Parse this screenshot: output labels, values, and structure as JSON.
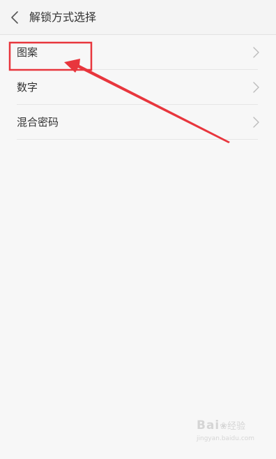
{
  "header": {
    "title": "解锁方式选择",
    "back_icon": "chevron-left-icon"
  },
  "options": [
    {
      "label": "图案",
      "icon": "chevron-right-icon"
    },
    {
      "label": "数字",
      "icon": "chevron-right-icon"
    },
    {
      "label": "混合密码",
      "icon": "chevron-right-icon"
    }
  ],
  "annotation": {
    "color": "#e8363d",
    "target": "图案"
  },
  "watermark": {
    "brand": "Bai",
    "brand_suffix": "经验",
    "url": "jingyan.baidu.com"
  },
  "colors": {
    "background": "#f7f7f7",
    "text": "#333333",
    "chevron": "#bbbbbb",
    "divider": "#e6e6e6"
  }
}
